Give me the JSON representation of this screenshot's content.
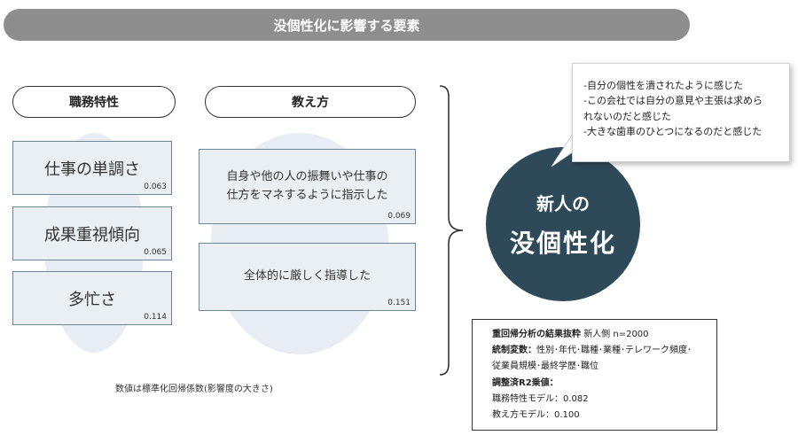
{
  "title": "没個性化に影響する要素",
  "categories": [
    {
      "label": "職務特性",
      "factors": [
        {
          "text": "仕事の単調さ",
          "coef": "0.063"
        },
        {
          "text": "成果重視傾向",
          "coef": "0.065"
        },
        {
          "text": "多忙さ",
          "coef": "0.114"
        }
      ]
    },
    {
      "label": "教え方",
      "factors": [
        {
          "line1": "自身や他の人の振舞いや仕事の",
          "line2": "仕方をマネするように指示した",
          "coef": "0.069"
        },
        {
          "text": "全体的に厳しく指導した",
          "coef": "0.151"
        }
      ]
    }
  ],
  "note": "数値は標準化回帰係数(影響度の大きさ)",
  "outcome": {
    "line1": "新人の",
    "line2": "没個性化"
  },
  "quotes": [
    "-自分の個性を潰されたように感じた",
    "-この会社では自分の意見や主張は求めら",
    "れないのだと感じた",
    "-大きな歯車のひとつになるのだと感じた"
  ],
  "results": {
    "heading": "重回帰分析の結果抜粋",
    "sample": "新人側 n=2000",
    "controls_label": "統制変数：",
    "controls_line1": "性別･年代･職種･業種･テレワーク頻度･",
    "controls_line2": "従業員規模･最終学歴･職位",
    "r2_label": "調整済R2乗値：",
    "model1": "職務特性モデル：0.082",
    "model2": "教え方モデル：0.100"
  },
  "colors": {
    "title_bar": "#8e8e8e",
    "box_fill": "#e9eff3",
    "box_border": "#6d8594",
    "ellipse_fill": "#e7edf2",
    "circle_fill": "#2e4a58"
  }
}
